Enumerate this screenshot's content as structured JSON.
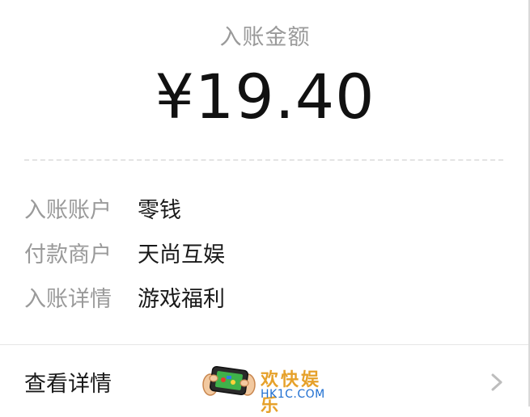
{
  "receipt": {
    "amount_label": "入账金额",
    "amount": "¥19.40",
    "fields": [
      {
        "key": "入账账户",
        "value": "零钱"
      },
      {
        "key": "付款商户",
        "value": "天尚互娱"
      },
      {
        "key": "入账详情",
        "value": "游戏福利"
      }
    ],
    "detail_link": "查看详情"
  },
  "watermark": {
    "title": "欢快娱乐",
    "domain": "HK1C.COM",
    "icon": "gamepad-hands-icon"
  },
  "colors": {
    "label_gray": "#9a9a9a",
    "text_dark": "#1a1a1a",
    "watermark_orange": "#e6a12a",
    "watermark_blue": "#1f6fd1"
  }
}
